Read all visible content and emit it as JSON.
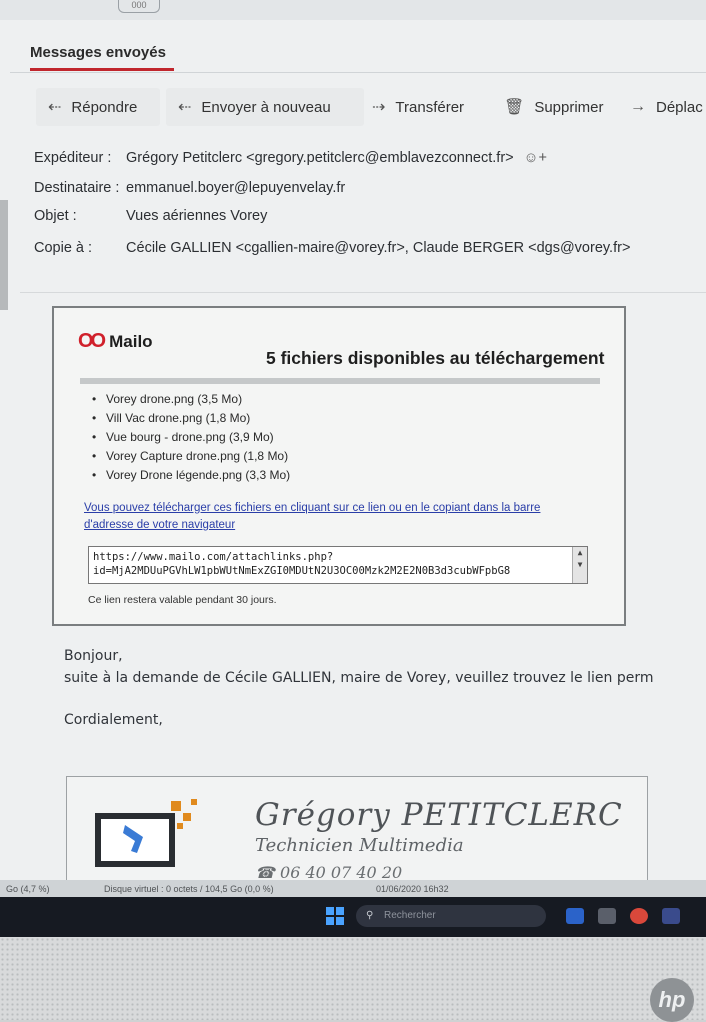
{
  "window": {
    "top_tab_label": "000"
  },
  "tabbar": {
    "active_tab": "Messages envoyés"
  },
  "toolbar": {
    "reply": "Répondre",
    "resend": "Envoyer à nouveau",
    "forward": "Transférer",
    "delete": "Supprimer",
    "move": "Déplac"
  },
  "header": {
    "sender_label": "Expéditeur :",
    "sender_value": "Grégory Petitclerc <gregory.petitclerc@emblavezconnect.fr>",
    "recipient_label": "Destinataire :",
    "recipient_value": "emmanuel.boyer@lepuyenvelay.fr",
    "subject_label": "Objet :",
    "subject_value": "Vues aériennes Vorey",
    "cc_label": "Copie à :",
    "cc_value": "Cécile GALLIEN <cgallien-maire@vorey.fr>, Claude BERGER <dgs@vorey.fr>"
  },
  "mailo": {
    "logo_text": "Mailo",
    "title": "5 fichiers disponibles au téléchargement",
    "files": [
      "Vorey drone.png (3,5 Mo)",
      "Vill Vac drone.png (1,8 Mo)",
      "Vue bourg - drone.png (3,9 Mo)",
      "Vorey Capture drone.png (1,8 Mo)",
      "Vorey Drone légende.png (3,3 Mo)"
    ],
    "download_link": "Vous pouvez télécharger ces fichiers en cliquant sur ce lien ou en le copiant dans la barre d'adresse de votre navigateur",
    "url_line1": "https://www.mailo.com/attachlinks.php?",
    "url_line2": "id=MjA2MDUuPGVhLW1pbWUtNmExZGI0MDUtN2U3OC00Mzk2M2E2N0B3d3cubWFpbG8",
    "validity": "Ce lien restera valable pendant 30 jours."
  },
  "body": {
    "greeting": "Bonjour,",
    "line1": "suite à la demande de Cécile GALLIEN, maire de Vorey, veuillez trouvez le lien perm",
    "closing": "Cordialement,"
  },
  "signature": {
    "name": "Grégory PETITCLERC",
    "role": "Technicien Multimedia",
    "phone": "06 40 07 40 20"
  },
  "statusbar": {
    "left": "Go (4,7 %)",
    "disk": "Disque virtuel : 0 octets / 104,5 Go (0,0 %)",
    "datetime": "01/06/2020 16h32"
  },
  "taskbar": {
    "search_placeholder": "Rechercher"
  },
  "brand": {
    "hp": "hp"
  },
  "colors": {
    "accent_red": "#c0262d",
    "mailo_red": "#d0202b",
    "link_blue": "#2a3ea8"
  }
}
